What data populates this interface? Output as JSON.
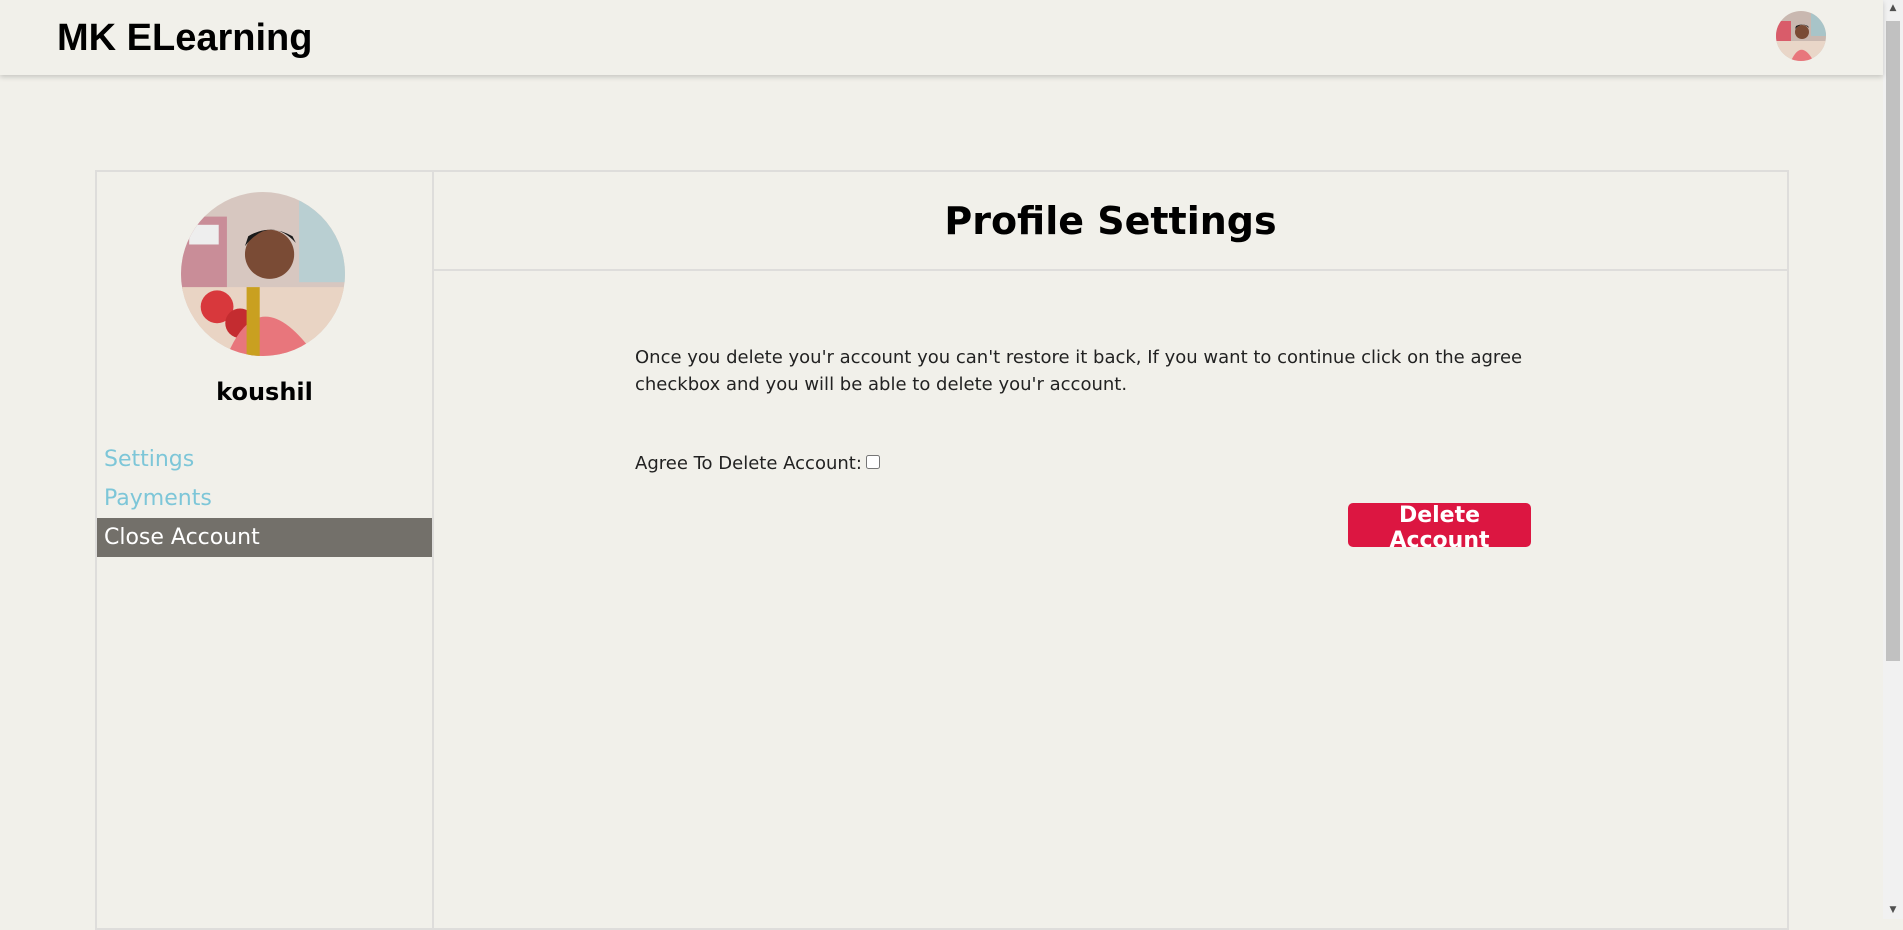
{
  "header": {
    "brand": "MK ELearning",
    "avatar_icon": "user-avatar-icon"
  },
  "sidebar": {
    "username": "koushil",
    "items": [
      {
        "label": "Settings",
        "active": false
      },
      {
        "label": "Payments",
        "active": false
      },
      {
        "label": "Close Account",
        "active": true
      }
    ]
  },
  "main": {
    "title": "Profile Settings",
    "warning": "Once you delete you'r account you can't restore it back, If you want to continue click on the agree checkbox and you will be able to delete you'r account.",
    "agree_label": "Agree To Delete Account:",
    "agree_checked": false,
    "delete_button": "Delete Account"
  },
  "colors": {
    "background": "#f1f0ea",
    "nav_link": "#7dc6d8",
    "nav_active_bg": "#73706a",
    "danger": "#dc1641"
  }
}
